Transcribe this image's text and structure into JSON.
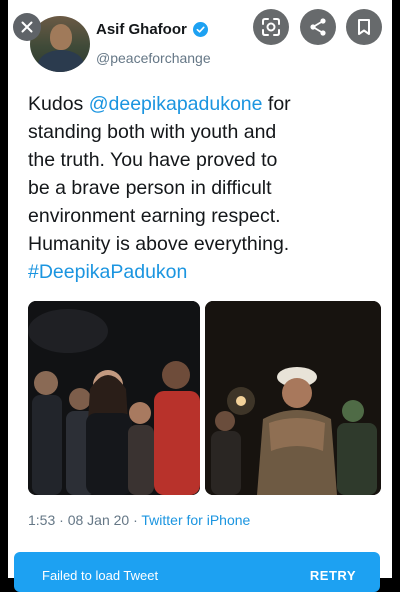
{
  "tweet": {
    "author": {
      "name": "Asif Ghafoor",
      "handle": "@peaceforchange",
      "verified": true
    },
    "text_lines": [
      {
        "pre": "Kudos ",
        "link": "@deepikapadukone",
        "post": " for"
      },
      {
        "text": "standing both with youth and"
      },
      {
        "text": "the truth. You have proved to"
      },
      {
        "text": "be a brave person in difficult"
      },
      {
        "text": "environment earning respect."
      },
      {
        "text": "Humanity is above everything."
      },
      {
        "link": "#DeepikaPadukon"
      }
    ],
    "timestamp": "1:53 · 08 Jan 20 · ",
    "source": "Twitter for iPhone"
  },
  "overlay": {
    "close_icon": "close-icon",
    "lens_icon": "lens-icon",
    "share_icon": "share-icon",
    "bookmark_icon": "bookmark-icon"
  },
  "error_bar": {
    "message": "Failed to load Tweet",
    "retry_label": "RETRY"
  },
  "colors": {
    "link": "#1b95e0",
    "verified": "#1da1f2",
    "error_bar": "#1da1f2"
  }
}
